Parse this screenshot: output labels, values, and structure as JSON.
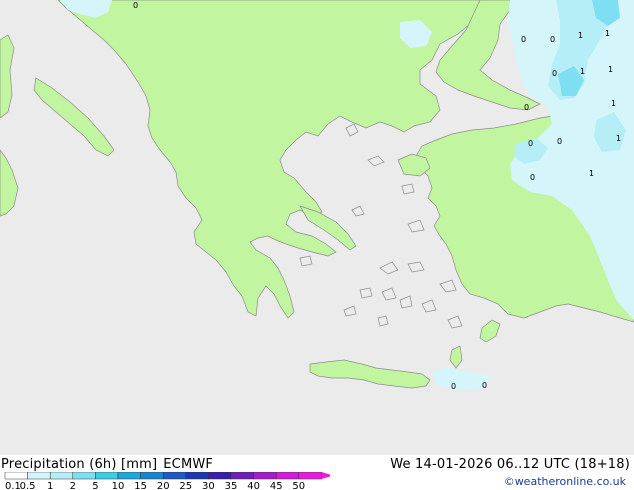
{
  "product": {
    "title_parts": [
      "Precipitation (6h) [mm]",
      "ECMWF"
    ],
    "valid_time": "We 14-01-2026 06..12 UTC (18+18)",
    "copyright": "©weatheronline.co.uk"
  },
  "colors": {
    "sea": "#ebebeb",
    "land": "#c2f5a0",
    "coast": "#8c8c8c"
  },
  "legend": {
    "values": [
      "0.1",
      "0.5",
      "1",
      "2",
      "5",
      "10",
      "15",
      "20",
      "25",
      "30",
      "35",
      "40",
      "45",
      "50"
    ],
    "colors": [
      "#ffffff",
      "#d4f6fb",
      "#b6eef8",
      "#7fdff2",
      "#3ecbe6",
      "#20a6d8",
      "#1c83cc",
      "#1e5bc2",
      "#1d37b0",
      "#3a1fa8",
      "#6e1fb7",
      "#a11fc7",
      "#cf1fd4",
      "#e81fd8"
    ]
  },
  "map_labels": {
    "values": [
      "0",
      "0",
      "1",
      "1",
      "0",
      "0",
      "1",
      "1",
      "0",
      "1",
      "0",
      "0",
      "1",
      "0",
      "1",
      "0",
      "0"
    ]
  }
}
